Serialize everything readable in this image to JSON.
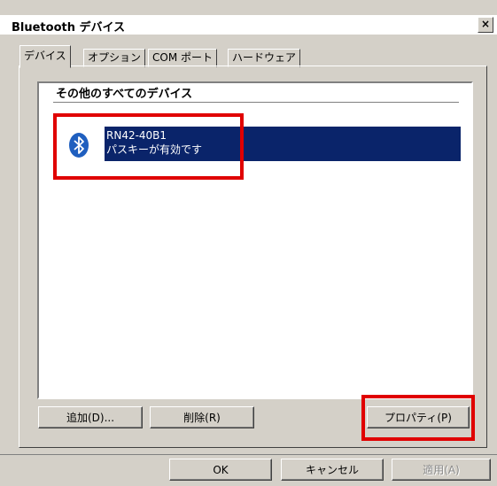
{
  "window": {
    "title": "Bluetooth デバイス",
    "close_label": "×"
  },
  "tabs": [
    {
      "label": "デバイス"
    },
    {
      "label": "オプション"
    },
    {
      "label": "COM ポート"
    },
    {
      "label": "ハードウェア"
    }
  ],
  "device_list": {
    "group_header": "その他のすべてのデバイス",
    "items": [
      {
        "name": "RN42-40B1",
        "status": "パスキーが有効です",
        "icon": "bluetooth-icon",
        "selected": true
      }
    ]
  },
  "panel_buttons": {
    "add": "追加(D)...",
    "remove": "削除(R)",
    "properties": "プロパティ(P)"
  },
  "dialog_buttons": {
    "ok": "OK",
    "cancel": "キャンセル",
    "apply": "適用(A)"
  },
  "colors": {
    "selection": "#0a246a",
    "highlight_box": "#e00000",
    "bluetooth_blue": "#1f5fbf",
    "dialog_bg": "#d4d0c8"
  }
}
